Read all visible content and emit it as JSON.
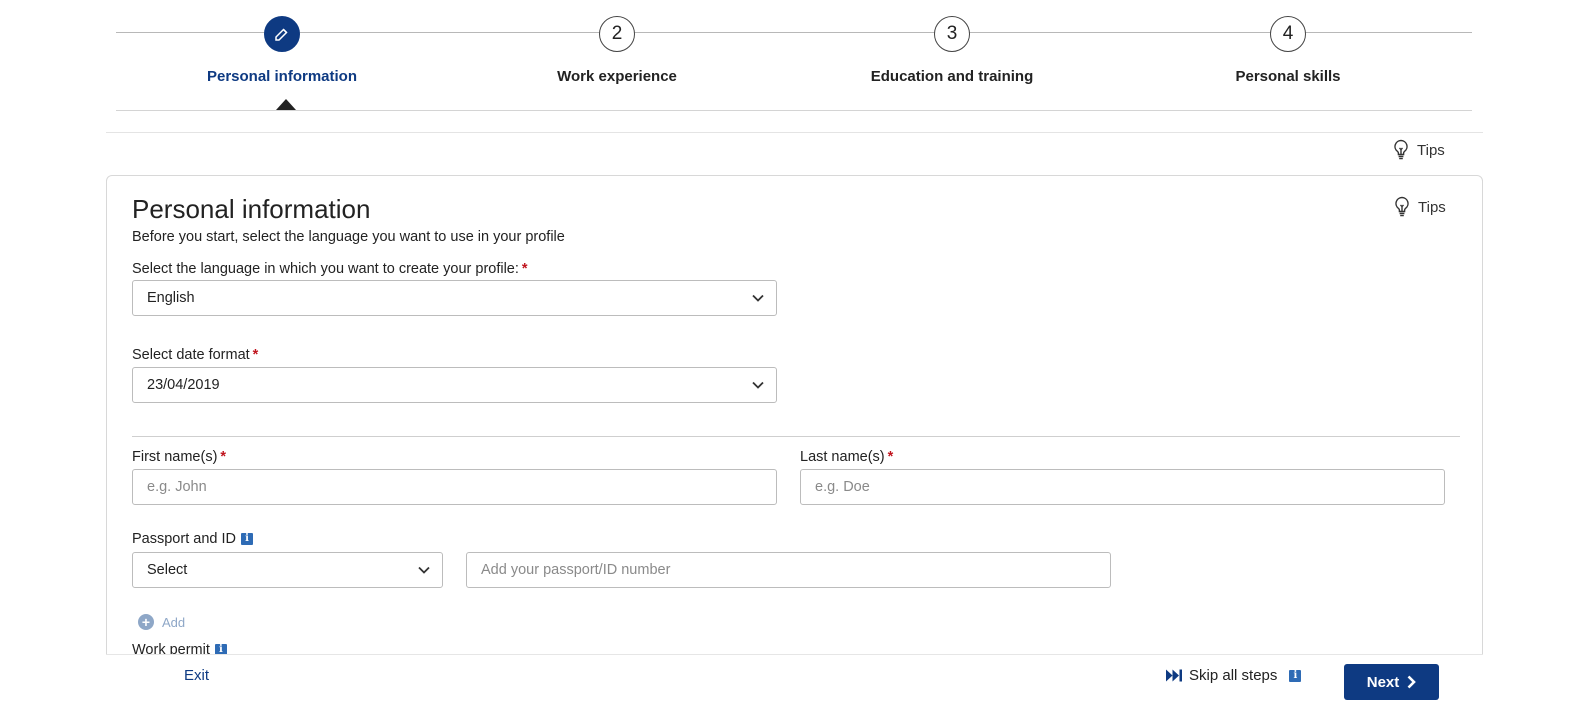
{
  "stepper": {
    "steps": [
      {
        "number": "",
        "label": "Personal information",
        "state": "active"
      },
      {
        "number": "2",
        "label": "Work experience",
        "state": "pending"
      },
      {
        "number": "3",
        "label": "Education and training",
        "state": "pending"
      },
      {
        "number": "4",
        "label": "Personal skills",
        "state": "pending"
      }
    ]
  },
  "tips_label": "Tips",
  "card": {
    "title": "Personal information",
    "subtitle": "Before you start, select the language you want to use in your profile",
    "tips_label": "Tips"
  },
  "form": {
    "language": {
      "label": "Select the language in which you want to create your profile:",
      "value": "English"
    },
    "date_format": {
      "label": "Select date format",
      "value": "23/04/2019"
    },
    "first_name": {
      "label": "First name(s)",
      "placeholder": "e.g. John"
    },
    "last_name": {
      "label": "Last name(s)",
      "placeholder": "e.g. Doe"
    },
    "passport": {
      "label": "Passport and ID",
      "select_value": "Select",
      "number_placeholder": "Add your passport/ID number"
    },
    "add_label": "Add",
    "work_permit_label": "Work permit",
    "required_mark": "*",
    "info_glyph": "i"
  },
  "footer": {
    "exit_label": "Exit",
    "skip_label": "Skip all steps",
    "next_label": "Next"
  },
  "colors": {
    "primary": "#0e3a82",
    "required": "#c0141e",
    "info": "#2e6bb5"
  }
}
